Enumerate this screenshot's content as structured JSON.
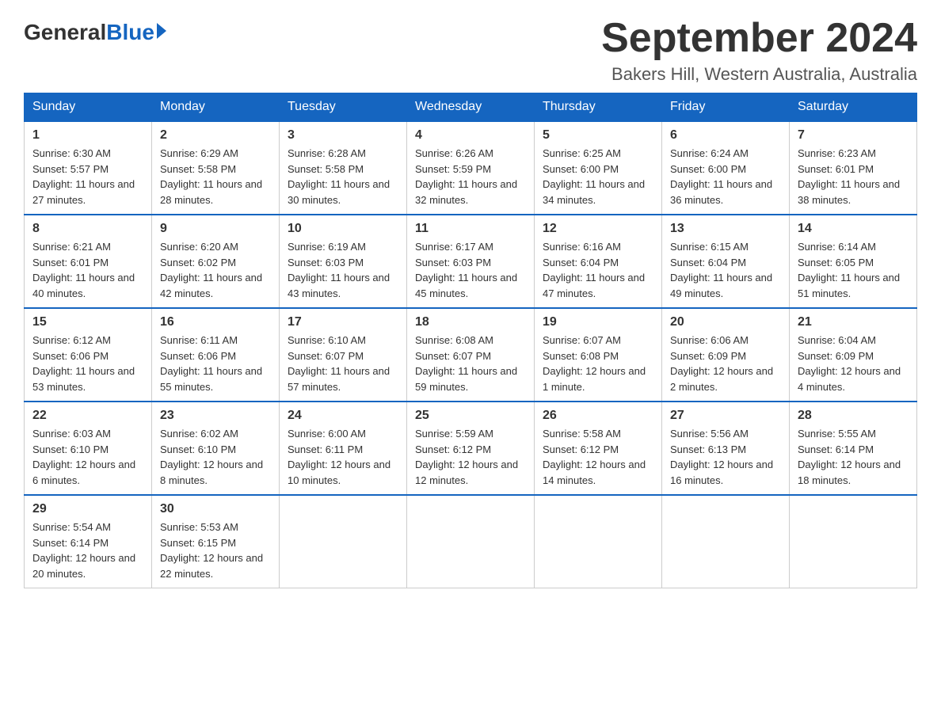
{
  "header": {
    "logo_general": "General",
    "logo_blue": "Blue",
    "month_title": "September 2024",
    "location": "Bakers Hill, Western Australia, Australia"
  },
  "days_of_week": [
    "Sunday",
    "Monday",
    "Tuesday",
    "Wednesday",
    "Thursday",
    "Friday",
    "Saturday"
  ],
  "weeks": [
    [
      {
        "day": "1",
        "sunrise": "6:30 AM",
        "sunset": "5:57 PM",
        "daylight": "11 hours and 27 minutes."
      },
      {
        "day": "2",
        "sunrise": "6:29 AM",
        "sunset": "5:58 PM",
        "daylight": "11 hours and 28 minutes."
      },
      {
        "day": "3",
        "sunrise": "6:28 AM",
        "sunset": "5:58 PM",
        "daylight": "11 hours and 30 minutes."
      },
      {
        "day": "4",
        "sunrise": "6:26 AM",
        "sunset": "5:59 PM",
        "daylight": "11 hours and 32 minutes."
      },
      {
        "day": "5",
        "sunrise": "6:25 AM",
        "sunset": "6:00 PM",
        "daylight": "11 hours and 34 minutes."
      },
      {
        "day": "6",
        "sunrise": "6:24 AM",
        "sunset": "6:00 PM",
        "daylight": "11 hours and 36 minutes."
      },
      {
        "day": "7",
        "sunrise": "6:23 AM",
        "sunset": "6:01 PM",
        "daylight": "11 hours and 38 minutes."
      }
    ],
    [
      {
        "day": "8",
        "sunrise": "6:21 AM",
        "sunset": "6:01 PM",
        "daylight": "11 hours and 40 minutes."
      },
      {
        "day": "9",
        "sunrise": "6:20 AM",
        "sunset": "6:02 PM",
        "daylight": "11 hours and 42 minutes."
      },
      {
        "day": "10",
        "sunrise": "6:19 AM",
        "sunset": "6:03 PM",
        "daylight": "11 hours and 43 minutes."
      },
      {
        "day": "11",
        "sunrise": "6:17 AM",
        "sunset": "6:03 PM",
        "daylight": "11 hours and 45 minutes."
      },
      {
        "day": "12",
        "sunrise": "6:16 AM",
        "sunset": "6:04 PM",
        "daylight": "11 hours and 47 minutes."
      },
      {
        "day": "13",
        "sunrise": "6:15 AM",
        "sunset": "6:04 PM",
        "daylight": "11 hours and 49 minutes."
      },
      {
        "day": "14",
        "sunrise": "6:14 AM",
        "sunset": "6:05 PM",
        "daylight": "11 hours and 51 minutes."
      }
    ],
    [
      {
        "day": "15",
        "sunrise": "6:12 AM",
        "sunset": "6:06 PM",
        "daylight": "11 hours and 53 minutes."
      },
      {
        "day": "16",
        "sunrise": "6:11 AM",
        "sunset": "6:06 PM",
        "daylight": "11 hours and 55 minutes."
      },
      {
        "day": "17",
        "sunrise": "6:10 AM",
        "sunset": "6:07 PM",
        "daylight": "11 hours and 57 minutes."
      },
      {
        "day": "18",
        "sunrise": "6:08 AM",
        "sunset": "6:07 PM",
        "daylight": "11 hours and 59 minutes."
      },
      {
        "day": "19",
        "sunrise": "6:07 AM",
        "sunset": "6:08 PM",
        "daylight": "12 hours and 1 minute."
      },
      {
        "day": "20",
        "sunrise": "6:06 AM",
        "sunset": "6:09 PM",
        "daylight": "12 hours and 2 minutes."
      },
      {
        "day": "21",
        "sunrise": "6:04 AM",
        "sunset": "6:09 PM",
        "daylight": "12 hours and 4 minutes."
      }
    ],
    [
      {
        "day": "22",
        "sunrise": "6:03 AM",
        "sunset": "6:10 PM",
        "daylight": "12 hours and 6 minutes."
      },
      {
        "day": "23",
        "sunrise": "6:02 AM",
        "sunset": "6:10 PM",
        "daylight": "12 hours and 8 minutes."
      },
      {
        "day": "24",
        "sunrise": "6:00 AM",
        "sunset": "6:11 PM",
        "daylight": "12 hours and 10 minutes."
      },
      {
        "day": "25",
        "sunrise": "5:59 AM",
        "sunset": "6:12 PM",
        "daylight": "12 hours and 12 minutes."
      },
      {
        "day": "26",
        "sunrise": "5:58 AM",
        "sunset": "6:12 PM",
        "daylight": "12 hours and 14 minutes."
      },
      {
        "day": "27",
        "sunrise": "5:56 AM",
        "sunset": "6:13 PM",
        "daylight": "12 hours and 16 minutes."
      },
      {
        "day": "28",
        "sunrise": "5:55 AM",
        "sunset": "6:14 PM",
        "daylight": "12 hours and 18 minutes."
      }
    ],
    [
      {
        "day": "29",
        "sunrise": "5:54 AM",
        "sunset": "6:14 PM",
        "daylight": "12 hours and 20 minutes."
      },
      {
        "day": "30",
        "sunrise": "5:53 AM",
        "sunset": "6:15 PM",
        "daylight": "12 hours and 22 minutes."
      },
      null,
      null,
      null,
      null,
      null
    ]
  ],
  "labels": {
    "sunrise_prefix": "Sunrise: ",
    "sunset_prefix": "Sunset: ",
    "daylight_prefix": "Daylight: "
  }
}
